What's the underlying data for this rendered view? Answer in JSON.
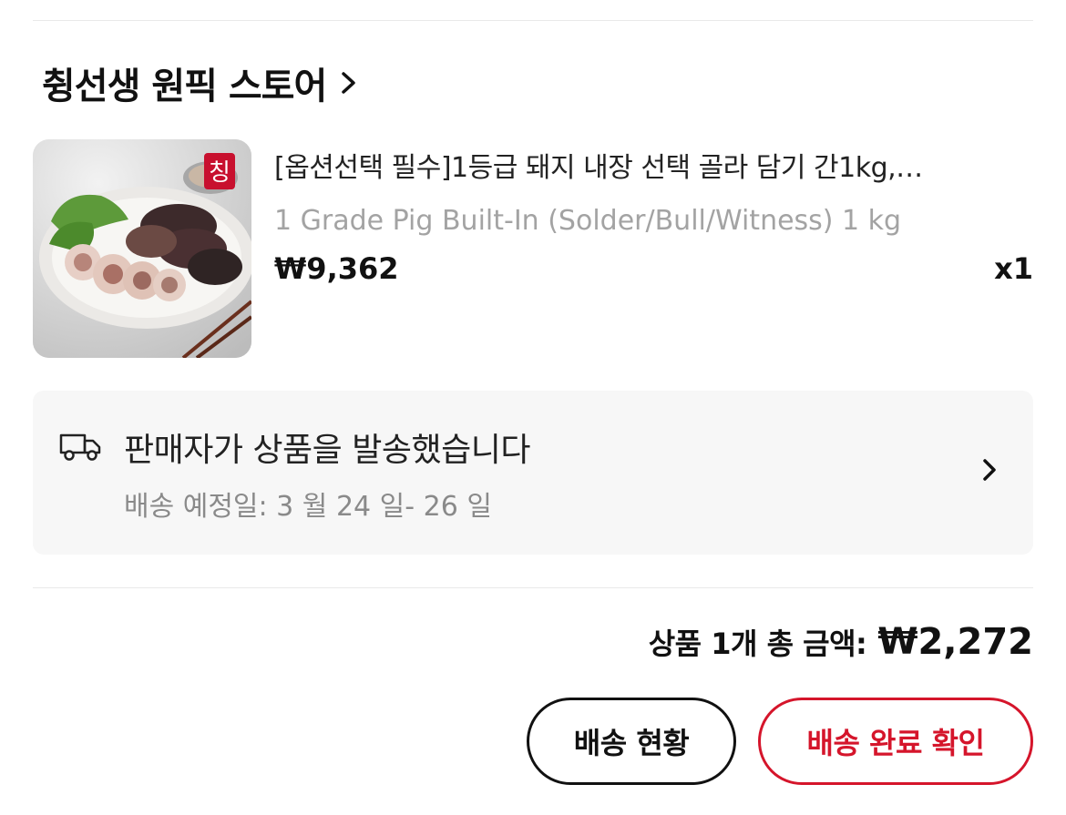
{
  "store": {
    "name": "췽선생 원픽 스토어",
    "chevron_icon": "chevron-right-icon"
  },
  "product": {
    "thumbnail_icon": "product-thumbnail",
    "title": "[옵션선택 필수]1등급 돼지 내장 선택 골라 담기 간1kg,…",
    "subtitle": "1 Grade Pig Built-In (Solder/Bull/Witness) 1 kg",
    "price": "₩9,362",
    "quantity": "x1"
  },
  "shipping": {
    "icon": "truck-icon",
    "status": "판매자가 상품을 발송했습니다",
    "estimated": "배송 예정일: 3 월 24 일- 26 일",
    "chevron_icon": "chevron-right-icon"
  },
  "summary": {
    "label": "상품 1개 총 금액:",
    "amount": "₩2,272"
  },
  "actions": {
    "track_label": "배송 현황",
    "confirm_label": "배송 완료 확인"
  },
  "colors": {
    "accent_red": "#d5152b",
    "muted_text": "#a3a3a3",
    "box_bg": "#f7f7f7"
  }
}
